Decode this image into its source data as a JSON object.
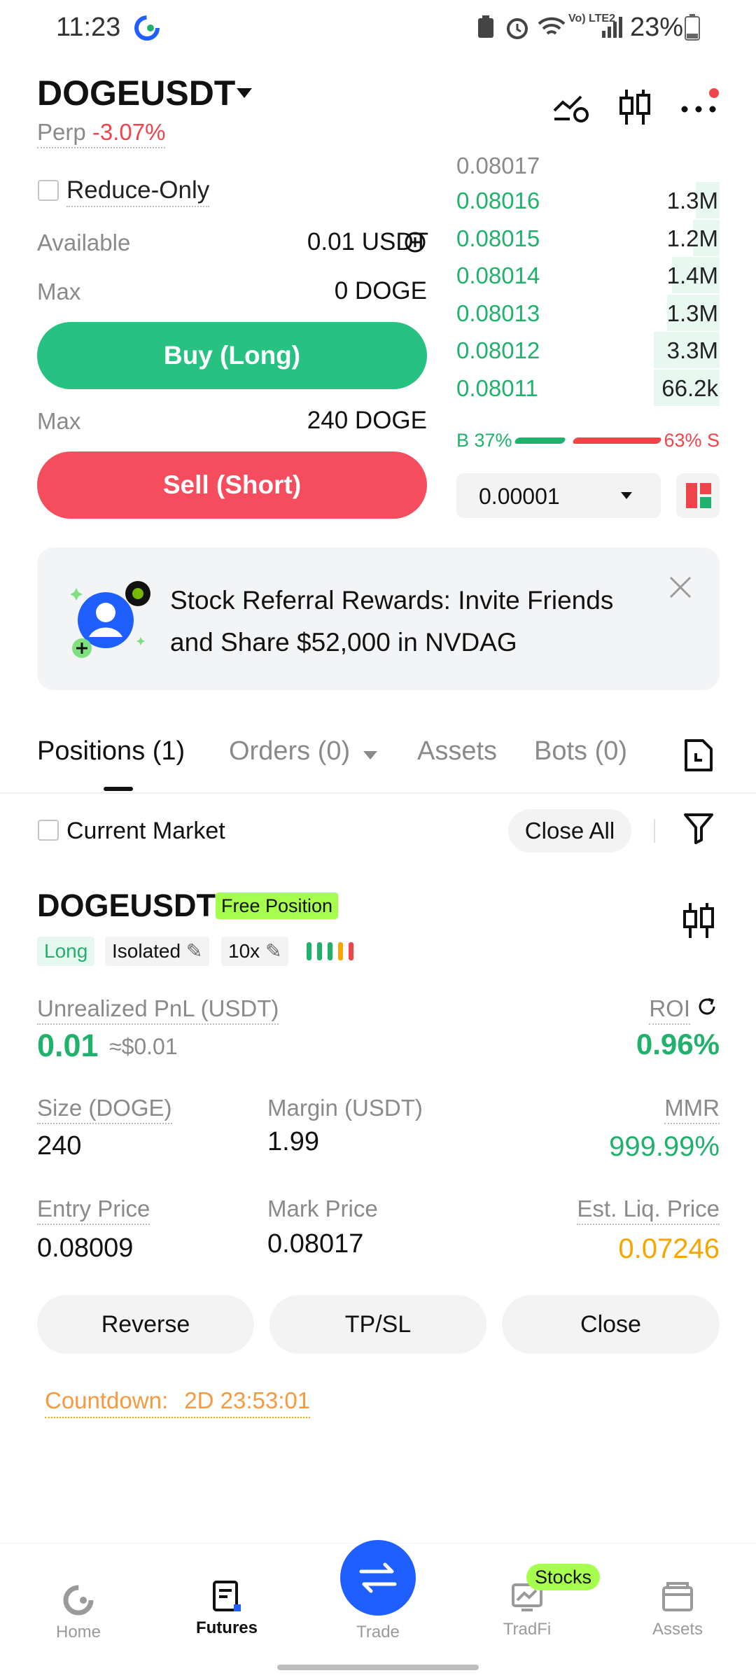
{
  "status_bar": {
    "time": "11:23",
    "battery": "23%",
    "network": "Vo) LTE2"
  },
  "header": {
    "symbol": "DOGEUSDT",
    "type": "Perp",
    "change": "-3.07%"
  },
  "order_form": {
    "reduce_only_label": "Reduce-Only",
    "available_label": "Available",
    "available_value": "0.01 USDT",
    "max_label_1": "Max",
    "max_value_1": "0 DOGE",
    "buy_label": "Buy (Long)",
    "max_label_2": "Max",
    "max_value_2": "240 DOGE",
    "sell_label": "Sell (Short)"
  },
  "order_book": {
    "top_price": "0.08017",
    "rows": [
      {
        "price": "0.08016",
        "qty": "1.3M",
        "depth": 0.09
      },
      {
        "price": "0.08015",
        "qty": "1.2M",
        "depth": 0.1
      },
      {
        "price": "0.08014",
        "qty": "1.4M",
        "depth": 0.18
      },
      {
        "price": "0.08013",
        "qty": "1.3M",
        "depth": 0.2
      },
      {
        "price": "0.08012",
        "qty": "3.3M",
        "depth": 0.25
      },
      {
        "price": "0.08011",
        "qty": "66.2k",
        "depth": 0.25
      }
    ],
    "buy_ratio_label": "B 37%",
    "sell_ratio_label": "63% S",
    "buy_ratio": 0.37,
    "tick_size": "0.00001"
  },
  "banner": {
    "text": "Stock Referral Rewards: Invite Friends and Share $52,000 in NVDAG"
  },
  "tabs": {
    "positions": "Positions (1)",
    "orders": "Orders (0)",
    "assets": "Assets",
    "bots": "Bots (0)"
  },
  "filter": {
    "current_market": "Current Market",
    "close_all": "Close All"
  },
  "position": {
    "symbol": "DOGEUSDT",
    "badge": "Free Position",
    "side": "Long",
    "margin_mode": "Isolated",
    "leverage": "10x",
    "unrealized_label": "Unrealized PnL (USDT)",
    "unrealized_value": "0.01",
    "unrealized_usd": "≈$0.01",
    "roi_label": "ROI",
    "roi_value": "0.96%",
    "size_label": "Size (DOGE)",
    "size_value": "240",
    "margin_label": "Margin (USDT)",
    "margin_value": "1.99",
    "mmr_label": "MMR",
    "mmr_value": "999.99%",
    "entry_label": "Entry Price",
    "entry_value": "0.08009",
    "mark_label": "Mark Price",
    "mark_value": "0.08017",
    "liq_label": "Est. Liq. Price",
    "liq_value": "0.07246",
    "reverse": "Reverse",
    "tpsl": "TP/SL",
    "close": "Close",
    "countdown_label": "Countdown:",
    "countdown_value": "2D 23:53:01"
  },
  "bottom_nav": {
    "home": "Home",
    "futures": "Futures",
    "trade": "Trade",
    "tradfi": "TradFi",
    "stocks_badge": "Stocks",
    "assets": "Assets"
  },
  "colors": {
    "green": "#20b26c",
    "red": "#ef454a",
    "orange": "#f7a600",
    "blue": "#1f5eff",
    "lime": "#a6ff4d"
  }
}
